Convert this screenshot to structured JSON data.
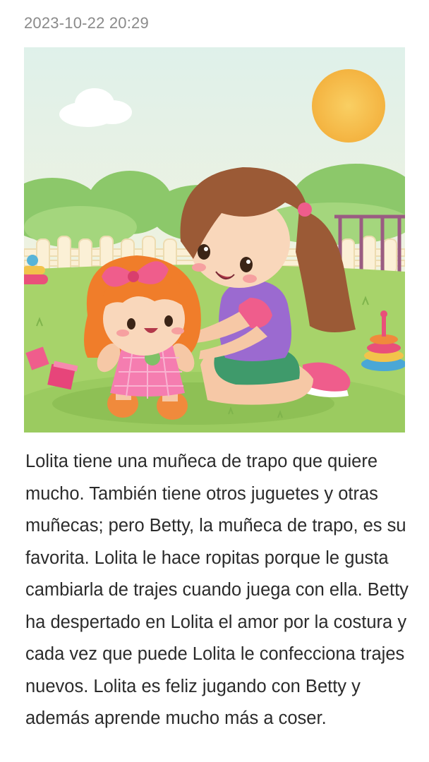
{
  "post": {
    "timestamp": "2023-10-22 20:29",
    "image": {
      "kind": "illustration",
      "subject": "girl-playing-with-rag-doll",
      "palette": {
        "sky": "#e8f4ec",
        "grass": "#a9d56b",
        "sun": "#f7c154",
        "hair_girl": "#9b5a36",
        "hair_doll": "#f07d2a",
        "shirt": "#9b6ad0",
        "shorts": "#3f9a6b",
        "dress": "#f57db0"
      }
    },
    "text": "Lolita tiene una muñeca de trapo que quiere mucho. También tiene otros juguetes y otras muñecas; pero Betty, la muñeca de trapo, es su favorita. Lolita le hace ropitas porque le gusta cambiarla de trajes cuando juega con ella. Betty ha despertado en Lolita el amor por la costura y cada vez que puede Lolita le confecciona trajes nuevos. Lolita es feliz jugando con Betty y además aprende mucho más a coser."
  },
  "colors": {
    "timestamp": "#8a8a8a",
    "body_text": "#2b2b2b",
    "background": "#ffffff"
  }
}
